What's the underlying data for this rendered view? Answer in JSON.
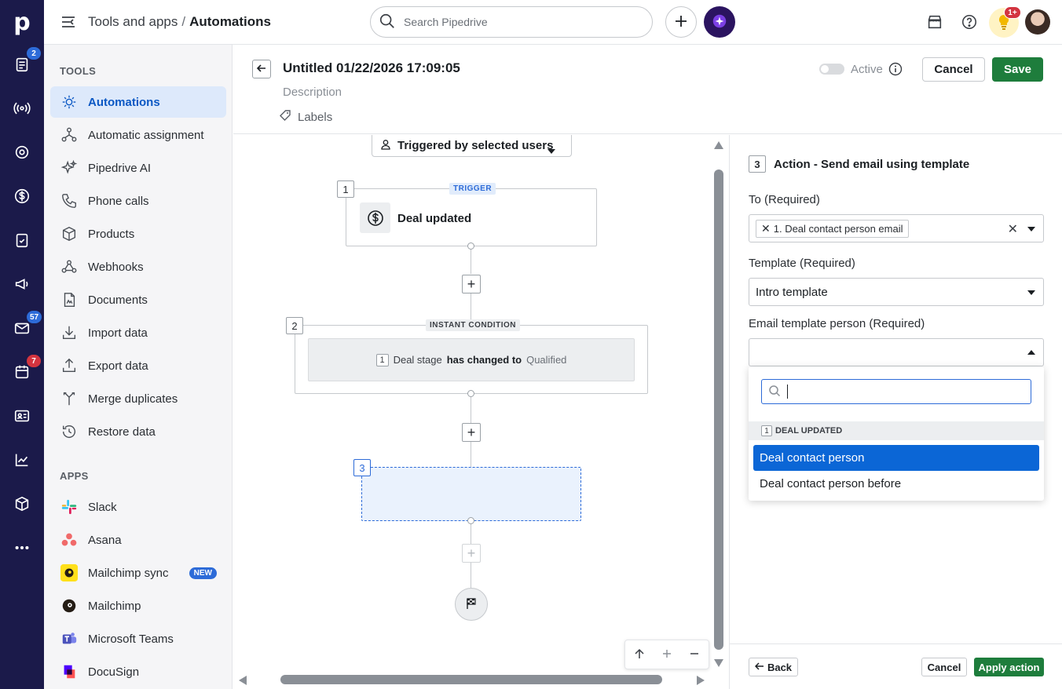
{
  "rail": {
    "logo": "p",
    "badges": {
      "leads": "2",
      "mail": "57",
      "calendar": "7"
    }
  },
  "topbar": {
    "breadcrumb_parent": "Tools and apps",
    "breadcrumb_sep": "/",
    "breadcrumb_current": "Automations",
    "search_placeholder": "Search Pipedrive",
    "notif_badge": "1+"
  },
  "sidebar": {
    "tools_title": "TOOLS",
    "tools": [
      {
        "label": "Automations",
        "icon": "automations-icon"
      },
      {
        "label": "Automatic assignment",
        "icon": "assignment-icon"
      },
      {
        "label": "Pipedrive AI",
        "icon": "sparkle-icon"
      },
      {
        "label": "Phone calls",
        "icon": "phone-icon"
      },
      {
        "label": "Products",
        "icon": "box-icon"
      },
      {
        "label": "Webhooks",
        "icon": "webhook-icon"
      },
      {
        "label": "Documents",
        "icon": "document-icon"
      },
      {
        "label": "Import data",
        "icon": "import-icon"
      },
      {
        "label": "Export data",
        "icon": "export-icon"
      },
      {
        "label": "Merge duplicates",
        "icon": "merge-icon"
      },
      {
        "label": "Restore data",
        "icon": "restore-icon"
      }
    ],
    "apps_title": "APPS",
    "apps": [
      {
        "label": "Slack",
        "icon": "slack-logo"
      },
      {
        "label": "Asana",
        "icon": "asana-logo"
      },
      {
        "label": "Mailchimp sync",
        "icon": "mailchimp-logo",
        "badge": "NEW"
      },
      {
        "label": "Mailchimp",
        "icon": "mailchimp-logo"
      },
      {
        "label": "Microsoft Teams",
        "icon": "teams-logo"
      },
      {
        "label": "DocuSign",
        "icon": "docusign-logo"
      }
    ]
  },
  "editor": {
    "title": "Untitled 01/22/2026 17:09:05",
    "description_placeholder": "Description",
    "labels": "Labels",
    "active_label": "Active",
    "cancel": "Cancel",
    "save": "Save"
  },
  "canvas": {
    "trigger_selector": "Triggered by selected users",
    "node1": {
      "num": "1",
      "tag": "TRIGGER",
      "label": "Deal updated"
    },
    "node2": {
      "num": "2",
      "tag": "INSTANT CONDITION",
      "cond_num": "1",
      "field": "Deal stage",
      "op": "has changed to",
      "value": "Qualified"
    },
    "node3": {
      "num": "3"
    }
  },
  "panel": {
    "step_num": "3",
    "title": "Action - Send email using template",
    "to_label": "To (Required)",
    "to_chip": "1. Deal contact person email",
    "template_label": "Template (Required)",
    "template_value": "Intro template",
    "person_label": "Email template person (Required)",
    "dropdown": {
      "group_num": "1",
      "group_label": "DEAL UPDATED",
      "options": [
        "Deal contact person",
        "Deal contact person before"
      ]
    },
    "back": "Back",
    "cancel": "Cancel",
    "apply": "Apply action"
  },
  "colors": {
    "rail": "#1b1a4a",
    "accent": "#0b66d6",
    "save_green": "#1e7d3c",
    "active_bg": "#dde9fb"
  }
}
